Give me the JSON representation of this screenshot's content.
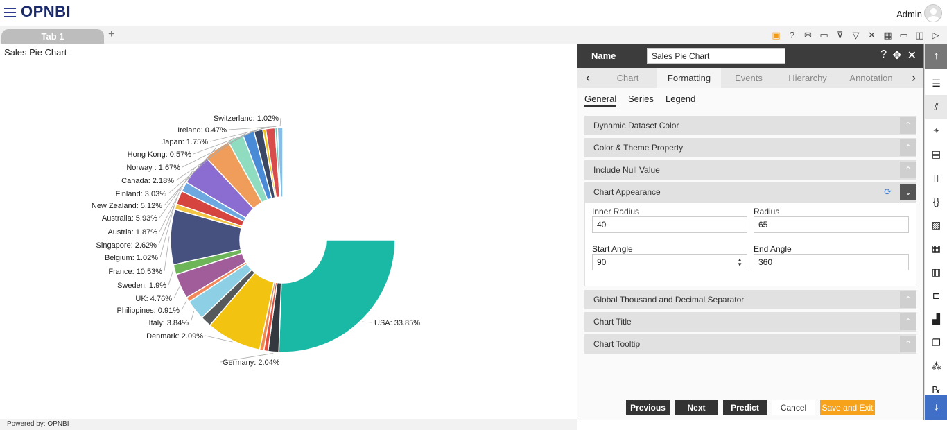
{
  "app": {
    "logo": "OPNBI",
    "user": "Admin"
  },
  "tabs": {
    "tab1": "Tab 1",
    "add": "+"
  },
  "toolbar_icons": [
    "save-icon",
    "help-icon",
    "mail-icon",
    "comment-icon",
    "clear-filter-icon",
    "filter-icon",
    "tools-icon",
    "table-icon",
    "screen-icon",
    "devices-icon",
    "play-icon"
  ],
  "chart_title": "Sales Pie Chart",
  "footer": "Powered by: OPNBI",
  "chart_data": {
    "type": "pie",
    "title": "Sales Pie Chart",
    "inner_radius_pct": 40,
    "radius_pct": 65,
    "start_angle": 90,
    "end_angle": 360,
    "slices": [
      {
        "label": "USA",
        "value": 33.85,
        "color": "#1ab9a6"
      },
      {
        "label": "Germany",
        "value": 2.04,
        "color": "#33393e"
      },
      {
        "label": "",
        "value": 0.8,
        "color": "#e74c3c"
      },
      {
        "label": "",
        "value": 0.8,
        "color": "#f08b4d"
      },
      {
        "label": "Denmark",
        "value": 10.5,
        "color": "#f2c311"
      },
      {
        "label": "",
        "value": 2.09,
        "color": "#55595c"
      },
      {
        "label": "Italy",
        "value": 3.84,
        "color": "#8dd0e6"
      },
      {
        "label": "Philippines",
        "value": 0.91,
        "color": "#f2875b"
      },
      {
        "label": "UK",
        "value": 4.76,
        "color": "#a05d99"
      },
      {
        "label": "Sweden",
        "value": 1.9,
        "color": "#6eb55a"
      },
      {
        "label": "France",
        "value": 10.53,
        "color": "#46517f"
      },
      {
        "label": "Belgium",
        "value": 1.02,
        "color": "#f2c543"
      },
      {
        "label": "Singapore",
        "value": 2.62,
        "color": "#d5443e"
      },
      {
        "label": "Austria",
        "value": 1.87,
        "color": "#6ea8e0"
      },
      {
        "label": "Australia",
        "value": 5.93,
        "color": "#8b6cd0"
      },
      {
        "label": "New Zealand",
        "value": 5.12,
        "color": "#f09d5c"
      },
      {
        "label": "Finland",
        "value": 3.03,
        "color": "#90dcc0"
      },
      {
        "label": "Canada",
        "value": 2.18,
        "color": "#4a8bd8"
      },
      {
        "label": "Norway ",
        "value": 1.67,
        "color": "#3a4866"
      },
      {
        "label": "Hong Kong",
        "value": 0.57,
        "color": "#f2c311"
      },
      {
        "label": "Japan",
        "value": 1.75,
        "color": "#d84c4c"
      },
      {
        "label": "Ireland",
        "value": 0.47,
        "color": "#75c9b9"
      },
      {
        "label": "Switzerland",
        "value": 1.02,
        "color": "#88bde8"
      }
    ],
    "labels": [
      {
        "text": "USA: 33.85%"
      },
      {
        "text": "Germany: 2.04%"
      },
      {
        "text": "Denmark: 2.09%"
      },
      {
        "text": "Italy: 3.84%"
      },
      {
        "text": "Philippines: 0.91%"
      },
      {
        "text": "UK: 4.76%"
      },
      {
        "text": "Sweden: 1.9%"
      },
      {
        "text": "France: 10.53%"
      },
      {
        "text": "Belgium: 1.02%"
      },
      {
        "text": "Singapore: 2.62%"
      },
      {
        "text": "Austria: 1.87%"
      },
      {
        "text": "Australia: 5.93%"
      },
      {
        "text": "New Zealand: 5.12%"
      },
      {
        "text": "Finland: 3.03%"
      },
      {
        "text": "Canada: 2.18%"
      },
      {
        "text": "Norway : 1.67%"
      },
      {
        "text": "Hong Kong: 0.57%"
      },
      {
        "text": "Japan: 1.75%"
      },
      {
        "text": "Ireland: 0.47%"
      },
      {
        "text": "Switzerland: 1.02%"
      }
    ]
  },
  "panel": {
    "name_label": "Name",
    "name_value": "Sales Pie Chart",
    "tabs": [
      "Chart",
      "Formatting",
      "Events",
      "Hierarchy",
      "Annotation"
    ],
    "subtabs": [
      "General",
      "Series",
      "Legend"
    ],
    "sections": {
      "dynamic_dataset_color": "Dynamic Dataset Color",
      "color_theme": "Color & Theme Property",
      "include_null": "Include Null Value",
      "chart_appearance": "Chart Appearance",
      "global_separator": "Global Thousand and Decimal Separator",
      "chart_title": "Chart Title",
      "chart_tooltip": "Chart Tooltip"
    },
    "fields": {
      "inner_radius_label": "Inner Radius",
      "inner_radius_value": "40",
      "radius_label": "Radius",
      "radius_value": "65",
      "start_angle_label": "Start Angle",
      "start_angle_value": "90",
      "end_angle_label": "End Angle",
      "end_angle_value": "360"
    },
    "buttons": {
      "previous": "Previous",
      "next": "Next",
      "predict": "Predict",
      "cancel": "Cancel",
      "save_exit": "Save and Exit"
    }
  },
  "rightbar_icons": [
    "collapse-up-icon",
    "list-icon",
    "chart-icon",
    "map-icon",
    "document-icon",
    "page-icon",
    "braces-icon",
    "image-icon",
    "table-icon",
    "calculator-icon",
    "hierarchy-icon",
    "bar-chart-icon",
    "copy-icon",
    "cluster-icon",
    "rx-icon",
    "download-icon"
  ]
}
